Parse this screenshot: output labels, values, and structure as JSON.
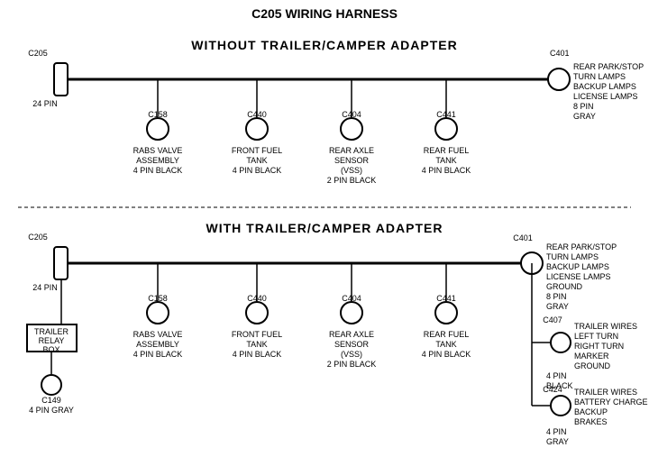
{
  "title": "C205 WIRING HARNESS",
  "section1": {
    "title": "WITHOUT  TRAILER/CAMPER  ADAPTER",
    "left_connector": {
      "label": "C205",
      "pin_label": "24 PIN"
    },
    "right_connector": {
      "label": "C401",
      "pin_label": "8 PIN",
      "color": "GRAY",
      "description": [
        "REAR PARK/STOP",
        "TURN LAMPS",
        "BACKUP LAMPS",
        "LICENSE LAMPS"
      ]
    },
    "connectors": [
      {
        "label": "C158",
        "desc": [
          "RABS VALVE",
          "ASSEMBLY",
          "4 PIN BLACK"
        ]
      },
      {
        "label": "C440",
        "desc": [
          "FRONT FUEL",
          "TANK",
          "4 PIN BLACK"
        ]
      },
      {
        "label": "C404",
        "desc": [
          "REAR AXLE",
          "SENSOR",
          "(VSS)",
          "2 PIN BLACK"
        ]
      },
      {
        "label": "C441",
        "desc": [
          "REAR FUEL",
          "TANK",
          "4 PIN BLACK"
        ]
      }
    ]
  },
  "section2": {
    "title": "WITH  TRAILER/CAMPER  ADAPTER",
    "left_connector": {
      "label": "C205",
      "pin_label": "24 PIN"
    },
    "right_connector": {
      "label": "C401",
      "pin_label": "8 PIN",
      "color": "GRAY",
      "description": [
        "REAR PARK/STOP",
        "TURN LAMPS",
        "BACKUP LAMPS",
        "LICENSE LAMPS",
        "GROUND"
      ]
    },
    "extra_left": {
      "box_label": "TRAILER\nRELAY\nBOX",
      "connector_label": "C149",
      "pin_label": "4 PIN GRAY"
    },
    "connectors": [
      {
        "label": "C158",
        "desc": [
          "RABS VALVE",
          "ASSEMBLY",
          "4 PIN BLACK"
        ]
      },
      {
        "label": "C440",
        "desc": [
          "FRONT FUEL",
          "TANK",
          "4 PIN BLACK"
        ]
      },
      {
        "label": "C404",
        "desc": [
          "REAR AXLE",
          "SENSOR",
          "(VSS)",
          "2 PIN BLACK"
        ]
      },
      {
        "label": "C441",
        "desc": [
          "REAR FUEL",
          "TANK",
          "4 PIN BLACK"
        ]
      }
    ],
    "right_connectors": [
      {
        "label": "C407",
        "pin_label": "4 PIN",
        "color": "BLACK",
        "description": [
          "TRAILER WIRES",
          "LEFT TURN",
          "RIGHT TURN",
          "MARKER",
          "GROUND"
        ]
      },
      {
        "label": "C424",
        "pin_label": "4 PIN",
        "color": "GRAY",
        "description": [
          "TRAILER WIRES",
          "BATTERY CHARGE",
          "BACKUP",
          "BRAKES"
        ]
      }
    ]
  }
}
